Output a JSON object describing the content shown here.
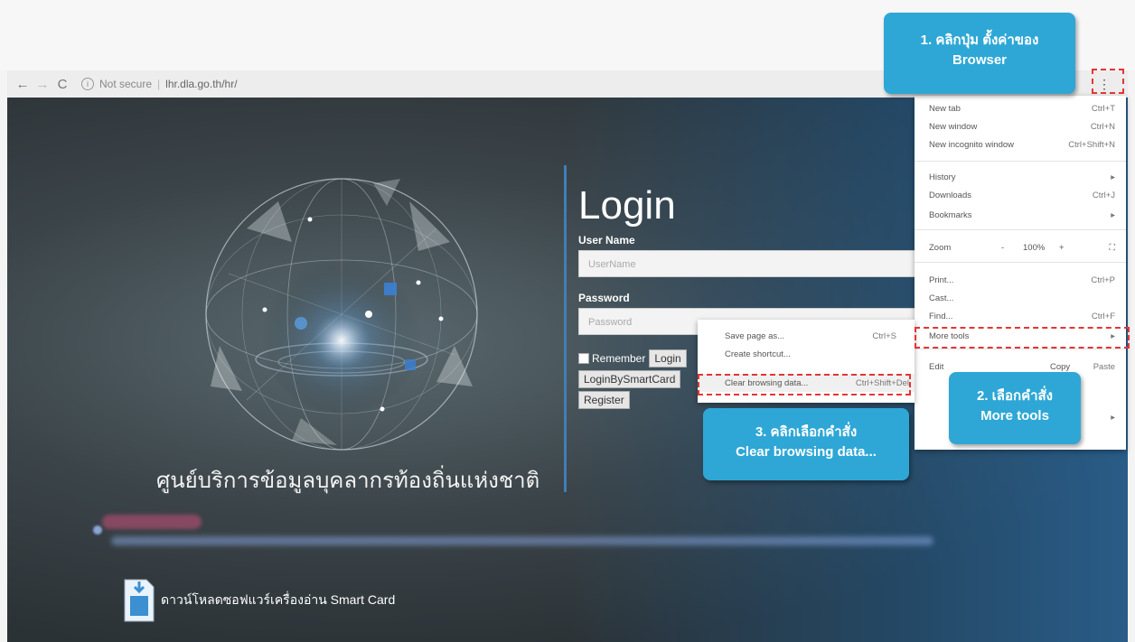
{
  "browser": {
    "back": "←",
    "forward": "→",
    "reload": "C",
    "security": "Not secure",
    "url": "lhr.dla.go.th/hr/",
    "menu_glyph": "⋮"
  },
  "site": {
    "title_th": "ศูนย์บริการข้อมูลบุคลากรท้องถิ่นแห่งชาติ",
    "login_heading": "Login",
    "username_label": "User Name",
    "username_placeholder": "UserName",
    "password_label": "Password",
    "password_placeholder": "Password",
    "remember_label": "Remember",
    "login_button": "Login",
    "smartcard_button": "LoginBySmartCard",
    "register_button": "Register",
    "download_text": "ดาวน์โหลดซอฟแวร์เครื่องอ่าน Smart Card"
  },
  "chrome_menu": {
    "new_tab": {
      "label": "New tab",
      "shortcut": "Ctrl+T"
    },
    "new_window": {
      "label": "New window",
      "shortcut": "Ctrl+N"
    },
    "incognito": {
      "label": "New incognito window",
      "shortcut": "Ctrl+Shift+N"
    },
    "history": {
      "label": "History",
      "arrow": "▸"
    },
    "downloads": {
      "label": "Downloads",
      "shortcut": "Ctrl+J"
    },
    "bookmarks": {
      "label": "Bookmarks",
      "arrow": "▸"
    },
    "zoom": {
      "label": "Zoom",
      "minus": "-",
      "value": "100%",
      "plus": "+",
      "fullscreen": "⛶"
    },
    "print": {
      "label": "Print...",
      "shortcut": "Ctrl+P"
    },
    "cast": {
      "label": "Cast..."
    },
    "find": {
      "label": "Find...",
      "shortcut": "Ctrl+F"
    },
    "more_tools": {
      "label": "More tools",
      "arrow": "▸"
    },
    "edit": {
      "label": "Edit",
      "copy": "Copy",
      "paste": "Paste"
    },
    "extra_arrow": "▸"
  },
  "more_tools_menu": {
    "save_page": {
      "label": "Save page as...",
      "shortcut": "Ctrl+S"
    },
    "create_shortcut": {
      "label": "Create shortcut..."
    },
    "clear_data": {
      "label": "Clear browsing data...",
      "shortcut": "Ctrl+Shift+Del"
    }
  },
  "callouts": {
    "step1_line1": "1. คลิกปุ่ม ตั้งค่าของ",
    "step1_line2": "Browser",
    "step2_line1": "2. เลือกคำสั่ง",
    "step2_line2": "More tools",
    "step3_line1": "3. คลิกเลือกคำสั่ง",
    "step3_line2": "Clear browsing data..."
  },
  "colors": {
    "callout": "#2ea7d6",
    "highlight_dash": "#e53535",
    "divider": "#3f7fb8"
  }
}
